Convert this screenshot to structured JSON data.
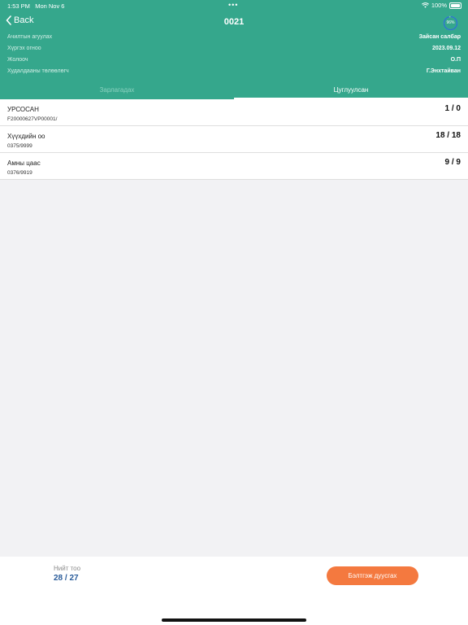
{
  "status_bar": {
    "time": "1:53 PM",
    "date": "Mon Nov 6",
    "battery": "100%",
    "icons": [
      "wifi-icon",
      "battery-icon"
    ]
  },
  "nav": {
    "back_label": "Back",
    "title": "0021",
    "progress_label": "96%",
    "progress_value": 0.96
  },
  "info": [
    {
      "label": "Ачилтын агуулах",
      "value": "Зайсан салбар"
    },
    {
      "label": "Хүргэх огноо",
      "value": "2023.09.12"
    },
    {
      "label": "Жолооч",
      "value": "О.П"
    },
    {
      "label": "Худалдааны төлөөлөгч",
      "value": "Г.Энхтайван"
    }
  ],
  "tabs": [
    {
      "label": "Зарлагадах",
      "active": false
    },
    {
      "label": "Цуглуулсан",
      "active": true
    }
  ],
  "items": [
    {
      "name": "УРСОСАН",
      "code": "F20000627VP00001/",
      "count": "1 / 0"
    },
    {
      "name": "Хүүхдийн оо",
      "code": "0375/9999",
      "count": "18 / 18"
    },
    {
      "name": "Амны цаас",
      "code": "0376/9919",
      "count": "9 / 9"
    }
  ],
  "footer": {
    "total_label": "Нийт тоо",
    "total_value": "28 / 27",
    "button_label": "Бэлтгэж дуусгах"
  },
  "colors": {
    "header_bg": "#35a78c",
    "button_bg": "#f4793f",
    "total_text": "#2a5c9a"
  }
}
